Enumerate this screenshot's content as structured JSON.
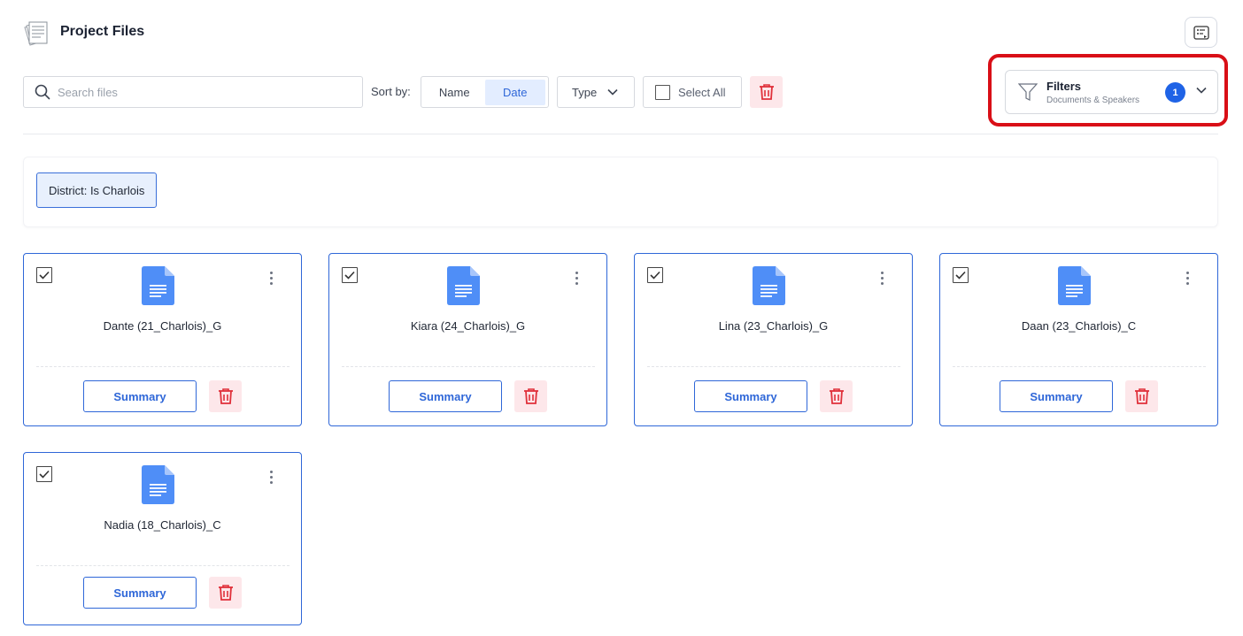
{
  "header": {
    "title": "Project Files"
  },
  "toolbar": {
    "search_placeholder": "Search files",
    "sort_label": "Sort by:",
    "sort_options": [
      "Name",
      "Date"
    ],
    "sort_selected": "Date",
    "type_label": "Type",
    "select_all_label": "Select All"
  },
  "filters": {
    "title": "Filters",
    "subtitle": "Documents & Speakers",
    "count": "1"
  },
  "active_filters": [
    {
      "label": "District: Is Charlois"
    }
  ],
  "files": [
    {
      "name": "Dante (21_Charlois)_G",
      "checked": true,
      "summary_label": "Summary"
    },
    {
      "name": "Kiara (24_Charlois)_G",
      "checked": true,
      "summary_label": "Summary"
    },
    {
      "name": "Lina (23_Charlois)_G",
      "checked": true,
      "summary_label": "Summary"
    },
    {
      "name": "Daan (23_Charlois)_C",
      "checked": true,
      "summary_label": "Summary"
    },
    {
      "name": "Nadia (18_Charlois)_C",
      "checked": true,
      "summary_label": "Summary"
    }
  ],
  "colors": {
    "accent": "#2f67d8",
    "danger": "#e0303a",
    "danger_bg": "#fde7ea",
    "highlight": "#d90f17",
    "doc_icon": "#4f8ef7"
  }
}
